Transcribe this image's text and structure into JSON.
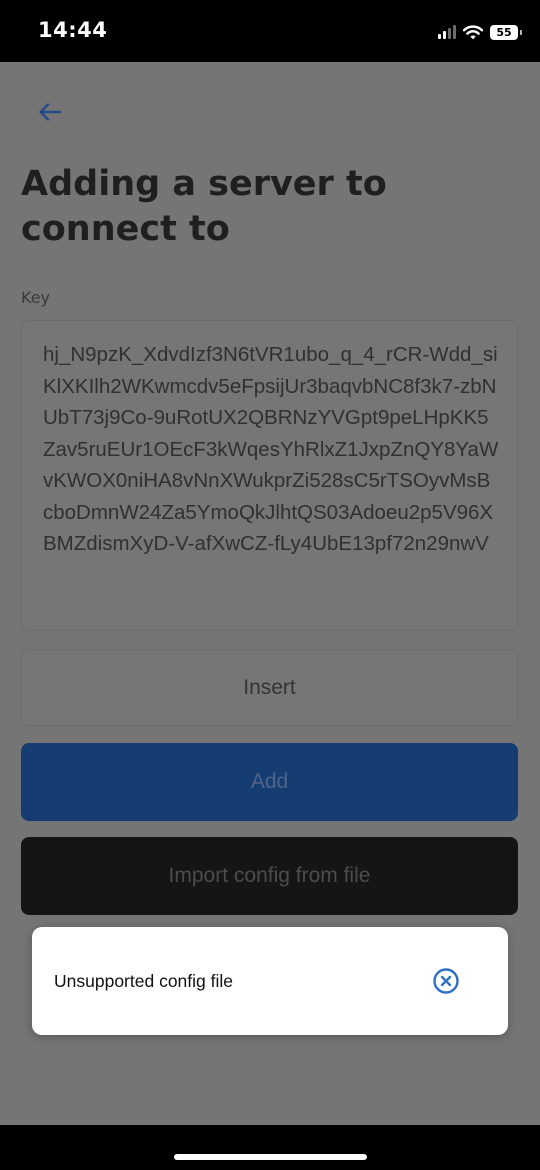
{
  "status": {
    "time": "14:44",
    "battery": "55"
  },
  "header": {
    "title": "Adding a server to connect to"
  },
  "form": {
    "key_label": "Key",
    "key_value": "hj_N9pzK_XdvdIzf3N6tVR1ubo_q_4_rCR-Wdd_siKlXKIlh2WKwmcdv5eFpsijUr3baqvbNC8f3k7-zbNUbT73j9Co-9uRotUX2QBRNzYVGpt9peLHpKK5Zav5ruEUr1OEcF3kWqesYhRlxZ1JxpZnQY8YaWvKWOX0niHA8vNnXWukprZi528sC5rTSOyvMsBcboDmnW24Za5YmoQkJlhtQS03Adoeu2p5V96XBMZdismXyD-V-afXwCZ-fLy4UbE13pf72n29nwV"
  },
  "buttons": {
    "insert": "Insert",
    "add": "Add",
    "import": "Import config from file"
  },
  "toast": {
    "message": "Unsupported config file"
  },
  "colors": {
    "accent": "#2f6fc4",
    "add_button_dimmed": "#163d72",
    "overlay": "#757575"
  },
  "icons": {
    "back": "arrow-left-icon",
    "close": "circle-x-icon",
    "signal": "cellular-signal-icon",
    "wifi": "wifi-icon",
    "battery": "battery-icon"
  }
}
